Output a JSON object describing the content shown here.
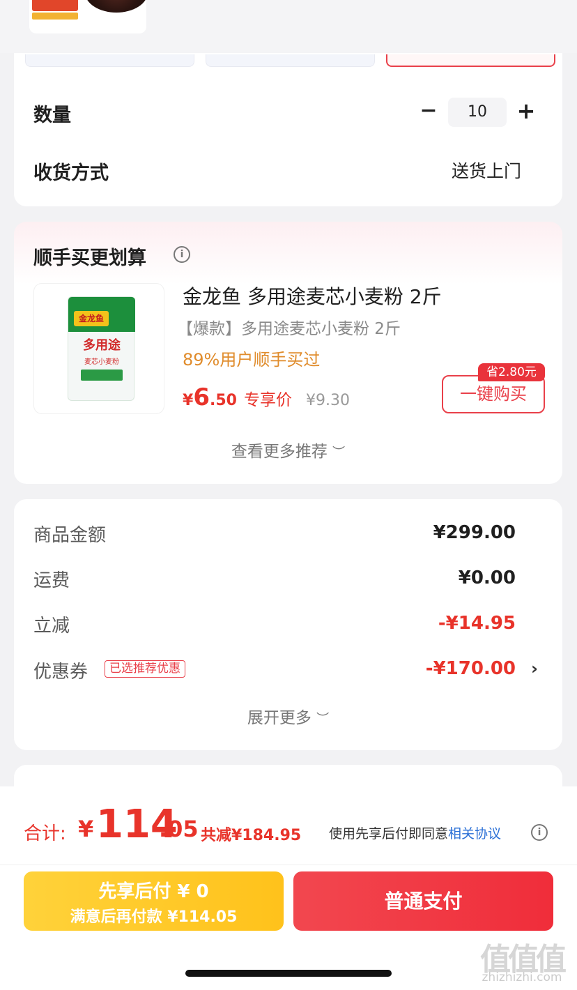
{
  "options": {
    "quantity_label": "数量",
    "quantity_value": "10",
    "delivery_label": "收货方式",
    "delivery_value": "送货上门"
  },
  "recommend": {
    "title": "顺手买更划算",
    "product_name": "金龙鱼 多用途麦芯小麦粉 2斤",
    "product_desc": "【爆款】多用途麦芯小麦粉 2斤",
    "users": "89%用户顺手买过",
    "price_symbol": "¥",
    "price_int": "6",
    "price_dec": ".50",
    "price_tag": "专享价",
    "price_original": "¥9.30",
    "save_badge": "省2.80元",
    "buy_button": "一键购买",
    "more": "查看更多推荐",
    "image_text": {
      "brand": "金龙鱼",
      "line1": "多用途",
      "line2": "麦芯小麦粉"
    }
  },
  "amounts": {
    "rows": [
      {
        "label": "商品金额",
        "value": "¥299.00"
      },
      {
        "label": "运费",
        "value": "¥0.00"
      },
      {
        "label": "立减",
        "value": "-¥14.95"
      },
      {
        "label": "优惠券",
        "value": "-¥170.00",
        "tag": "已选推荐优惠"
      }
    ],
    "expand": "展开更多"
  },
  "footer": {
    "total_label": "合计:",
    "total_symbol": "¥",
    "total_int": "114",
    "total_dec": ".05",
    "total_saved": "共减¥184.95",
    "agree_text": "使用先享后付即同意",
    "agree_link": "相关协议",
    "pay_later_line1": "先享后付 ¥ 0",
    "pay_later_line2": "满意后再付款 ¥114.05",
    "pay_normal": "普通支付"
  },
  "watermark": {
    "main": "值值值",
    "sub": "zhizhizhi.com"
  },
  "colors": {
    "accent_red": "#e8332a",
    "orange": "#e08c2c",
    "yellow_button": "#ffc21b",
    "link_blue": "#2a6fd6"
  }
}
